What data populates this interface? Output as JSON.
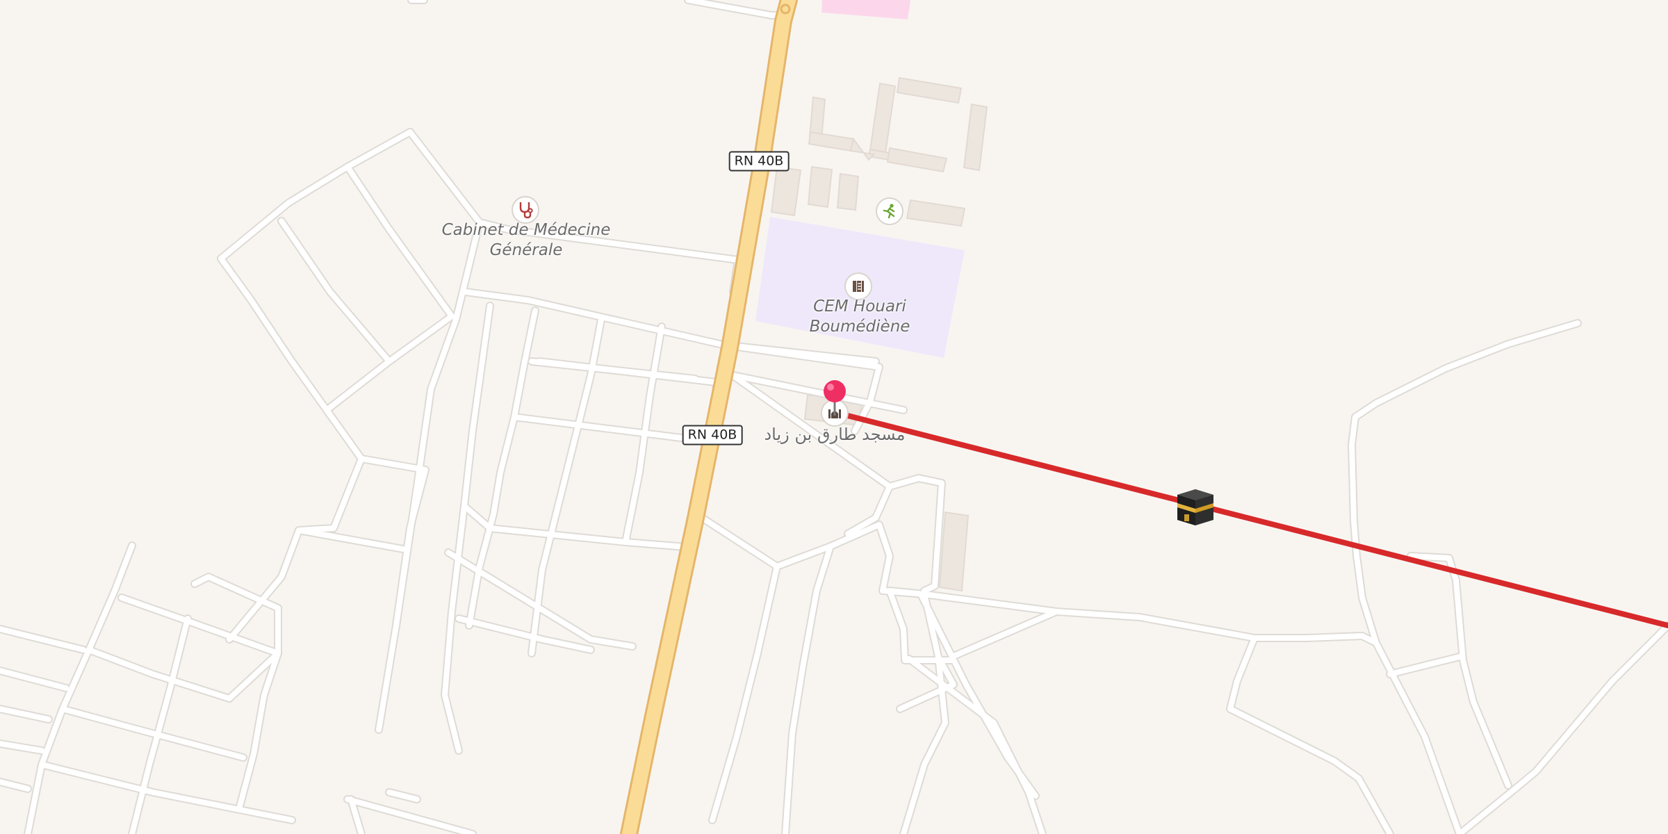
{
  "map": {
    "colors": {
      "land": "#f8f5f1",
      "minor_road": "#ffffff",
      "minor_road_casing": "#dedad5",
      "primary_road": "#fbdc96",
      "primary_road_casing": "#e5b56a",
      "building": "#ede6df",
      "school_area": "#eee8fa",
      "pink_area": "#fcd7eb",
      "qibla_line": "#d7292a",
      "pin": "#ef2f63"
    },
    "road_shields": [
      {
        "label": "RN 40B"
      },
      {
        "label": "RN 40B"
      }
    ],
    "pois": [
      {
        "icon": "stethoscope-icon",
        "label_lines": [
          "Cabinet de Médecine",
          "Générale"
        ]
      },
      {
        "icon": "school-icon",
        "label_lines": [
          "CEM Houari",
          "Boumédiène"
        ]
      },
      {
        "icon": "sports-icon",
        "label_lines": []
      },
      {
        "icon": "mosque-icon",
        "label_lines": [
          "مسجد طارق بن زياد"
        ]
      }
    ],
    "markers": [
      {
        "type": "location-pin"
      },
      {
        "type": "kaaba-icon"
      }
    ]
  }
}
